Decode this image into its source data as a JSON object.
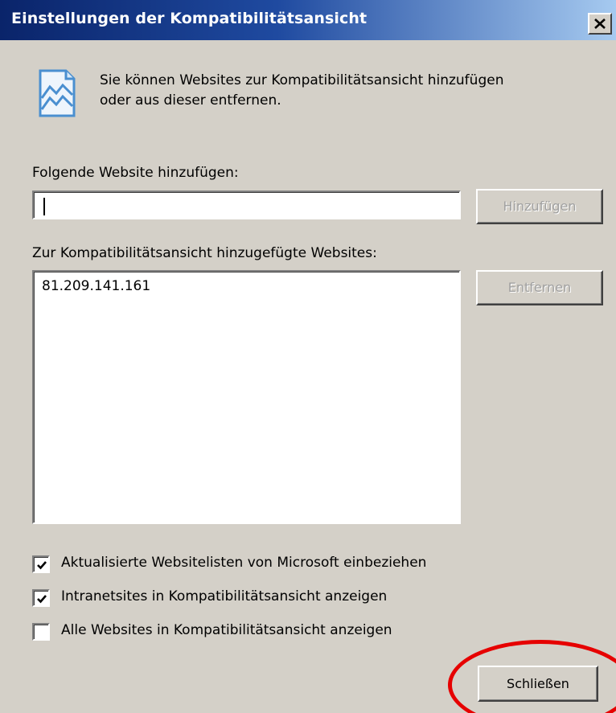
{
  "window": {
    "title": "Einstellungen der Kompatibilitätsansicht"
  },
  "intro": {
    "line1": "Sie können Websites zur Kompatibilitätsansicht hinzufügen",
    "line2": "oder aus dieser entfernen."
  },
  "add_site": {
    "label": "Folgende Website hinzufügen:",
    "value": "",
    "button_label": "Hinzufügen"
  },
  "site_list": {
    "label": "Zur Kompatibilitätsansicht hinzugefügte Websites:",
    "items": [
      "81.209.141.161"
    ],
    "remove_label": "Entfernen"
  },
  "options": [
    {
      "label": "Aktualisierte Websitelisten von Microsoft einbeziehen",
      "checked": true
    },
    {
      "label": "Intranetsites in Kompatibilitätsansicht anzeigen",
      "checked": true
    },
    {
      "label": "Alle Websites in Kompatibilitätsansicht anzeigen",
      "checked": false
    }
  ],
  "footer": {
    "close_label": "Schließen"
  },
  "icons": {
    "title_close": "close-icon",
    "info": "compatibility-view-icon",
    "check": "checkmark-icon"
  },
  "colors": {
    "titlebar_start": "#0a246a",
    "titlebar_end": "#a6caf0",
    "dialog_bg": "#d4d0c8",
    "highlight": "#e60000"
  }
}
